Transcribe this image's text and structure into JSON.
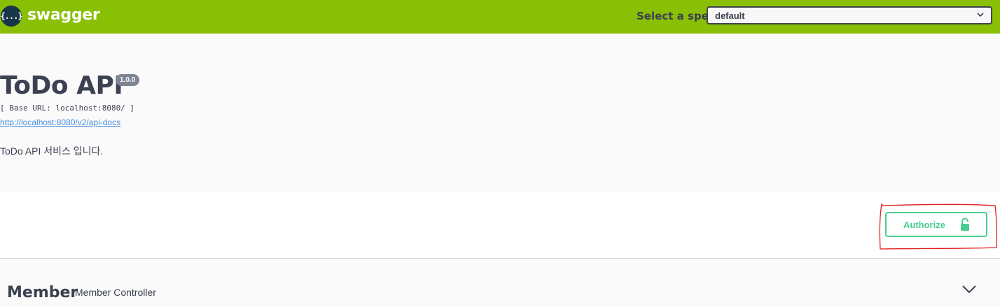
{
  "topbar": {
    "logo_icon": "{...}",
    "logo_text": "swagger",
    "spec_label": "Select a spec",
    "spec_selected": "default",
    "accent": "#89bf04"
  },
  "info": {
    "title": "ToDo API",
    "version": "1.0.0",
    "base_url": "[ Base URL: localhost:8080/ ]",
    "docs_link": "http://localhost:8080/v2/api-docs",
    "description": "ToDo API 서비스 입니다."
  },
  "auth": {
    "button_label": "Authorize",
    "icon": "unlock-icon",
    "color": "#49cc90",
    "annotation_color": "#e02020"
  },
  "tags": [
    {
      "name": "Member",
      "description": "Member Controller",
      "icon": "chevron-down-icon"
    }
  ]
}
